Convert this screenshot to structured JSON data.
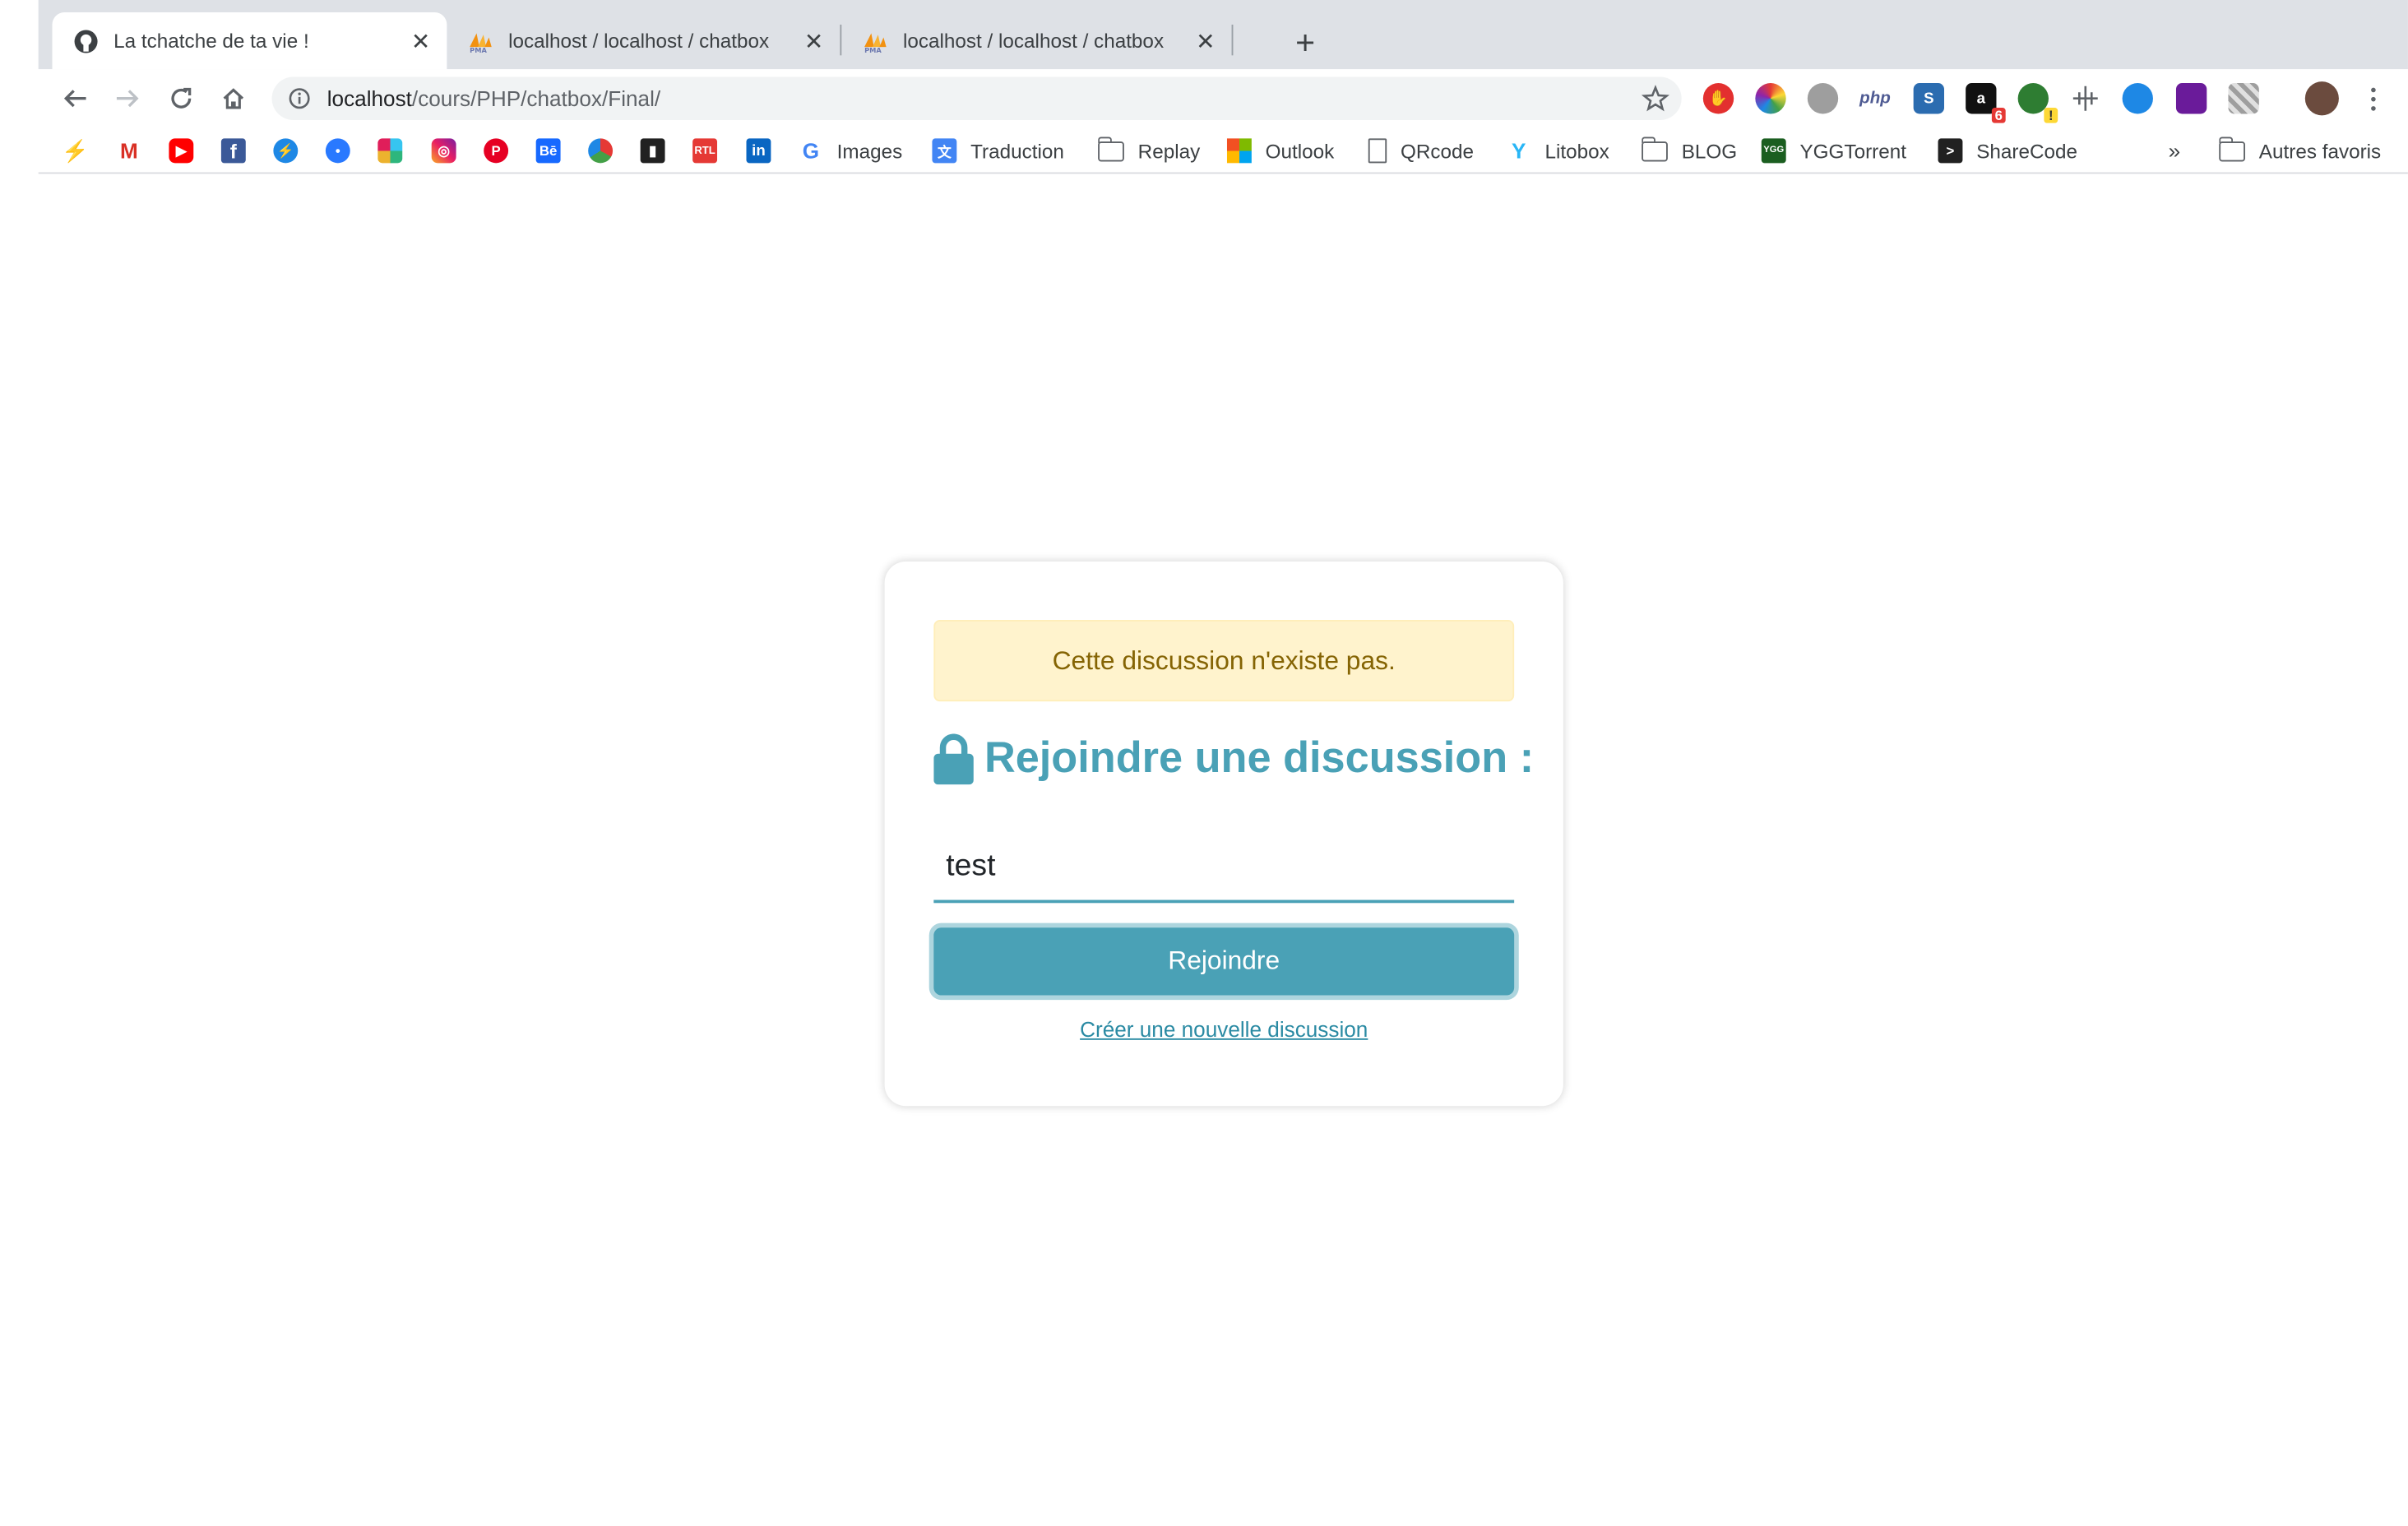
{
  "browser": {
    "tabs": [
      {
        "title": "La tchatche de ta vie !",
        "icon": "github-icon"
      },
      {
        "title": "localhost / localhost / chatbox",
        "icon": "phpmyadmin-icon"
      },
      {
        "title": "localhost / localhost / chatbox",
        "icon": "phpmyadmin-icon"
      }
    ],
    "url_host": "localhost",
    "url_path": "/cours/PHP/chatbox/Final/",
    "extensions_badges": {
      "amazon": "6",
      "globe": "!"
    },
    "extensions_php_label": "php",
    "bookmarks": [
      {
        "label": "Images"
      },
      {
        "label": "Traduction"
      },
      {
        "label": "Replay"
      },
      {
        "label": "Outlook"
      },
      {
        "label": "QRcode"
      },
      {
        "label": "Litobox"
      },
      {
        "label": "BLOG"
      },
      {
        "label": "YGGTorrent"
      },
      {
        "label": "ShareCode"
      }
    ],
    "bookmark_icon_text": {
      "behance": "Bē",
      "rtl": "RTL",
      "linkedin": "in",
      "gmail": "M",
      "facebook": "f",
      "ygg": "YGG"
    },
    "more_bookmarks": "»",
    "other_bookmarks": "Autres favoris"
  },
  "page": {
    "alert": "Cette discussion n'existe pas.",
    "heading": "Rejoindre une discussion :",
    "input_value": "test",
    "join_button": "Rejoindre",
    "create_link": "Créer une nouvelle discussion"
  },
  "colors": {
    "accent": "#4aa1b6",
    "alert_bg": "#fff3cd",
    "alert_text": "#856404"
  }
}
